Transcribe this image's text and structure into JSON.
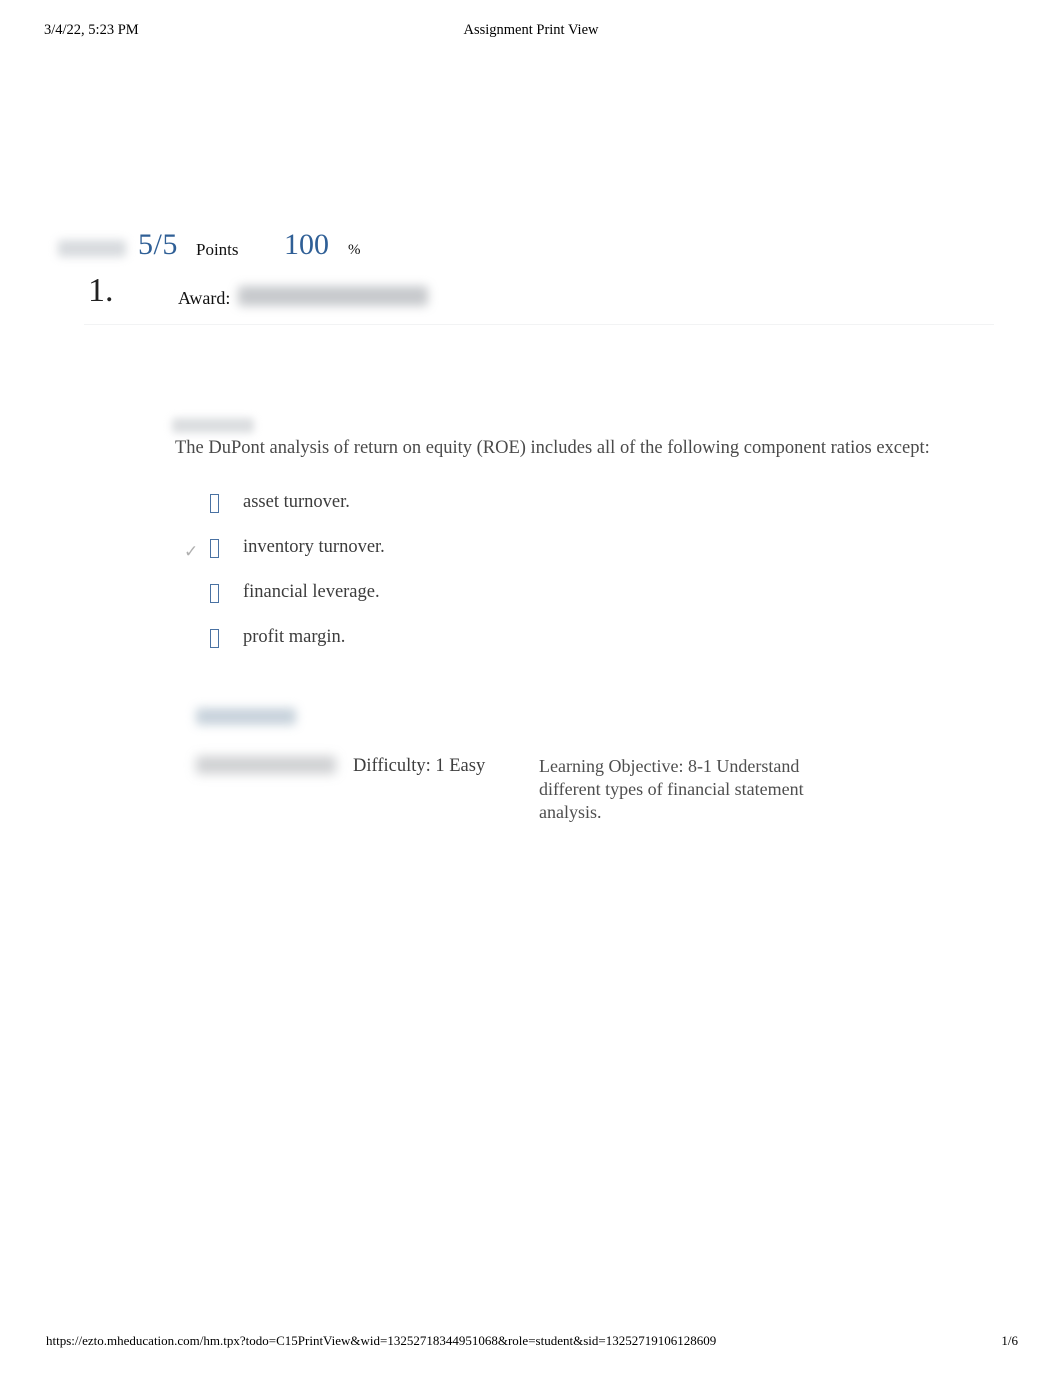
{
  "header": {
    "date": "3/4/22, 5:23 PM",
    "title": "Assignment Print View"
  },
  "score": {
    "points": "5/5",
    "points_label": "Points",
    "percent": "100",
    "percent_label": "%"
  },
  "question": {
    "number": "1.",
    "award_label": "Award:",
    "text": "The DuPont analysis of return on equity (ROE) includes all of the following component ratios except:",
    "options": [
      {
        "label": "asset turnover.",
        "selected": false,
        "check": ""
      },
      {
        "label": "inventory turnover.",
        "selected": true,
        "check": "✓"
      },
      {
        "label": "financial leverage.",
        "selected": false,
        "check": ""
      },
      {
        "label": "profit margin.",
        "selected": false,
        "check": ""
      }
    ]
  },
  "meta": {
    "difficulty": "Difficulty: 1 Easy",
    "objective": "Learning Objective: 8-1 Understand different types of financial statement analysis."
  },
  "footer": {
    "url": "https://ezto.mheducation.com/hm.tpx?todo=C15PrintView&wid=13252718344951068&role=student&sid=13252719106128609",
    "page": "1/6"
  },
  "colors": {
    "accent_blue": "#2f5f96",
    "radio_blue": "#4a72a3",
    "check_gray": "#b0b0b0",
    "body_text": "#4a4a4a"
  }
}
